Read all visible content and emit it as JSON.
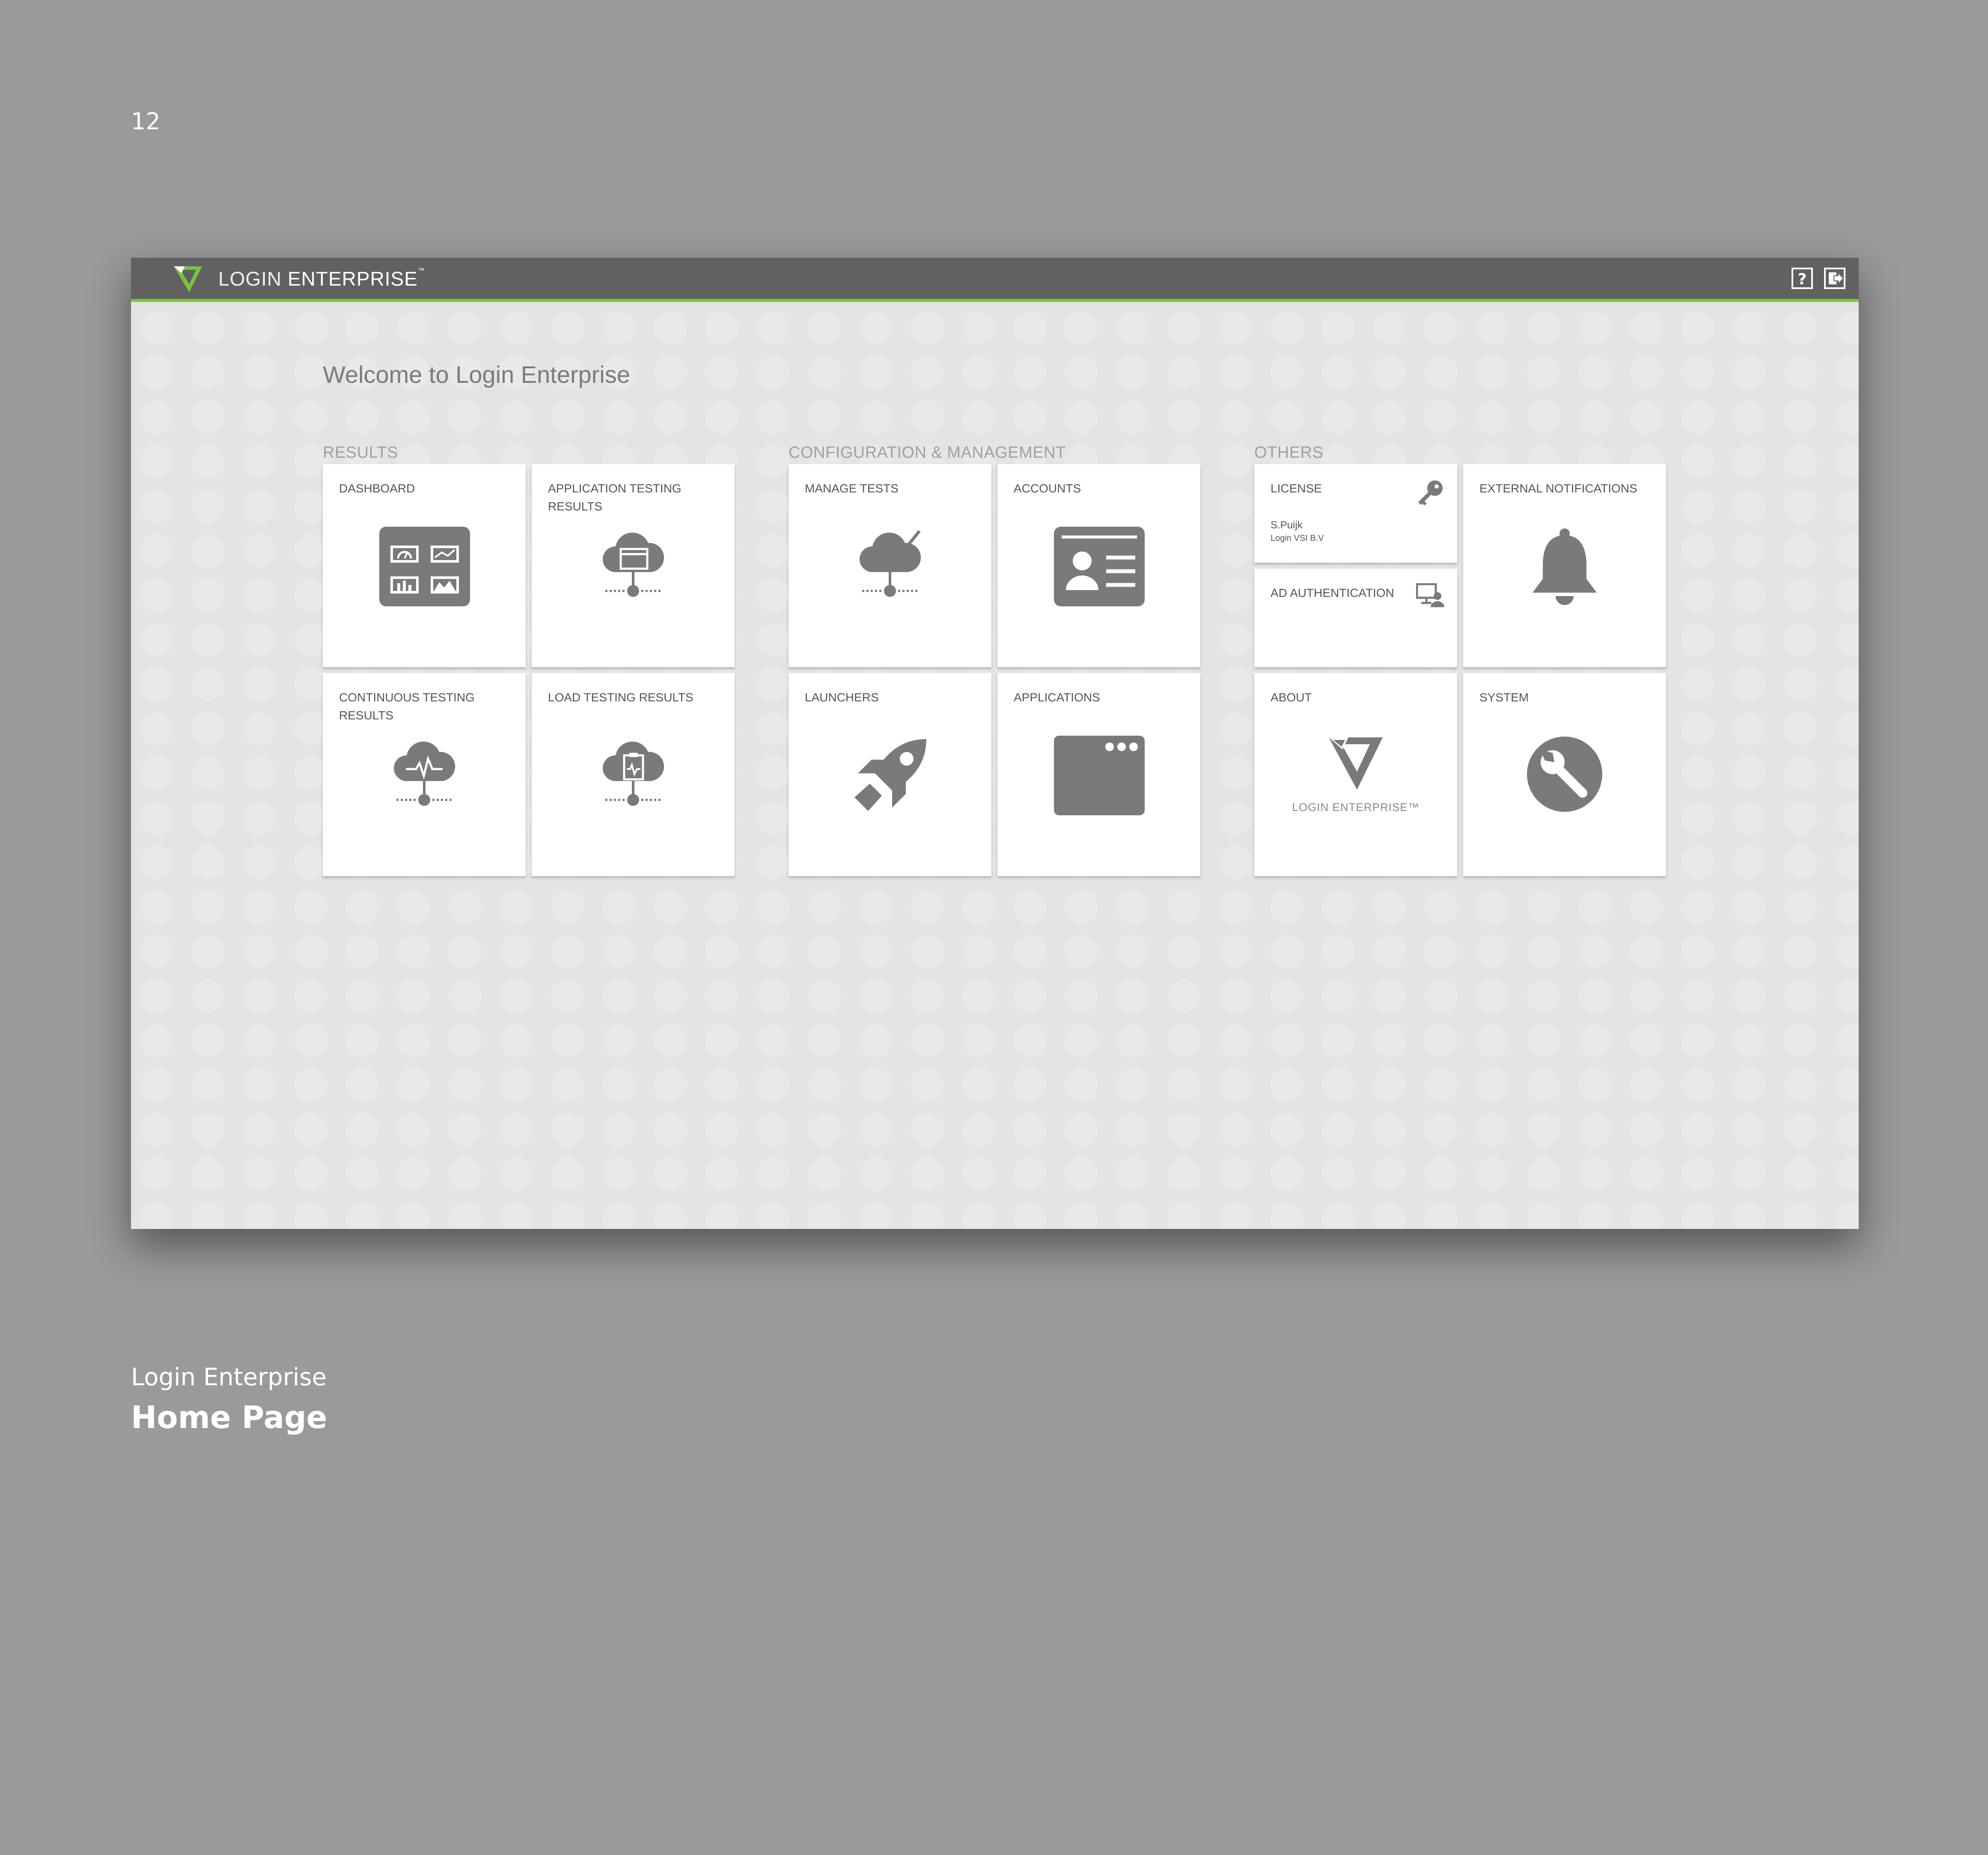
{
  "page_number": "12",
  "app": {
    "brand_light": "LOGIN ",
    "brand_bold": "ENTERPRISE",
    "brand_tm": "™",
    "accent_color": "#7cc243",
    "header_color": "#616161"
  },
  "toolbar": {
    "help_icon": "help-icon",
    "logout_icon": "logout-icon"
  },
  "welcome": "Welcome to Login Enterprise",
  "sections": {
    "results": "RESULTS",
    "config": "CONFIGURATION & MANAGEMENT",
    "others": "OTHERS"
  },
  "tiles": {
    "dashboard": "DASHBOARD",
    "app_testing": "APPLICATION TESTING RESULTS",
    "continuous": "CONTINUOUS TESTING RESULTS",
    "load_testing": "LOAD TESTING RESULTS",
    "manage_tests": "MANAGE TESTS",
    "accounts": "ACCOUNTS",
    "launchers": "LAUNCHERS",
    "applications": "APPLICATIONS",
    "license": "LICENSE",
    "license_user": "S.Puijk",
    "license_org": "Login VSI B.V",
    "ad_auth": "AD AUTHENTICATION",
    "external_notifications": "EXTERNAL NOTIFICATIONS",
    "about": "ABOUT",
    "about_brand": "LOGIN ENTERPRISE™",
    "system": "SYSTEM"
  },
  "caption": {
    "subtitle": "Login Enterprise",
    "title": "Home Page"
  }
}
